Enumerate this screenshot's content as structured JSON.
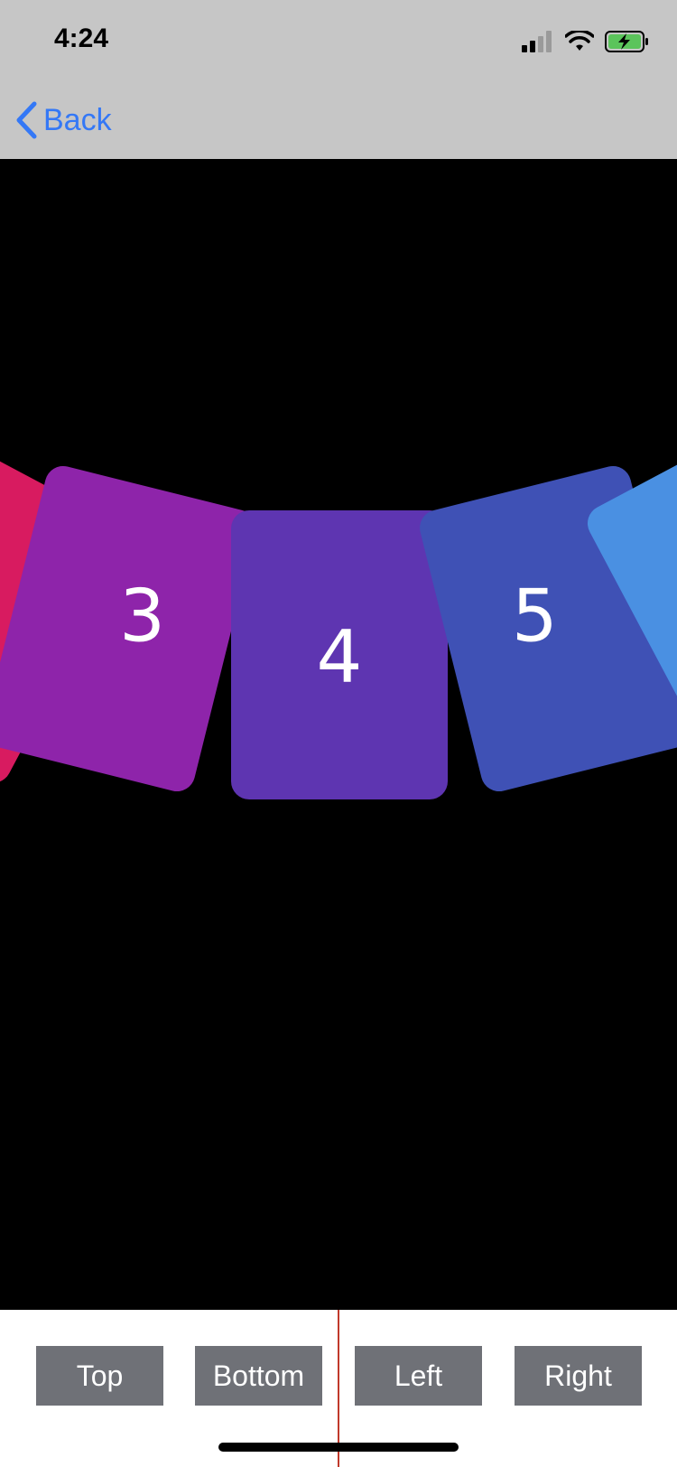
{
  "status_bar": {
    "time": "4:24"
  },
  "nav": {
    "back_label": "Back"
  },
  "cards": [
    {
      "label": "",
      "color": "#d81b60"
    },
    {
      "label": "3",
      "color": "#8e24aa"
    },
    {
      "label": "4",
      "color": "#5e35b1"
    },
    {
      "label": "5",
      "color": "#3f51b5"
    },
    {
      "label": "",
      "color": "#4a90e2"
    }
  ],
  "toolbar": {
    "buttons": [
      "Top",
      "Bottom",
      "Left",
      "Right"
    ]
  },
  "icons": {
    "back": "chevron-left-icon",
    "signal": "signal-icon",
    "wifi": "wifi-icon",
    "battery": "battery-charging-icon"
  },
  "colors": {
    "bar_background": "#c6c6c6",
    "accent_blue": "#3478f6",
    "button_gray": "#6f7177",
    "center_line": "#c0392b"
  }
}
